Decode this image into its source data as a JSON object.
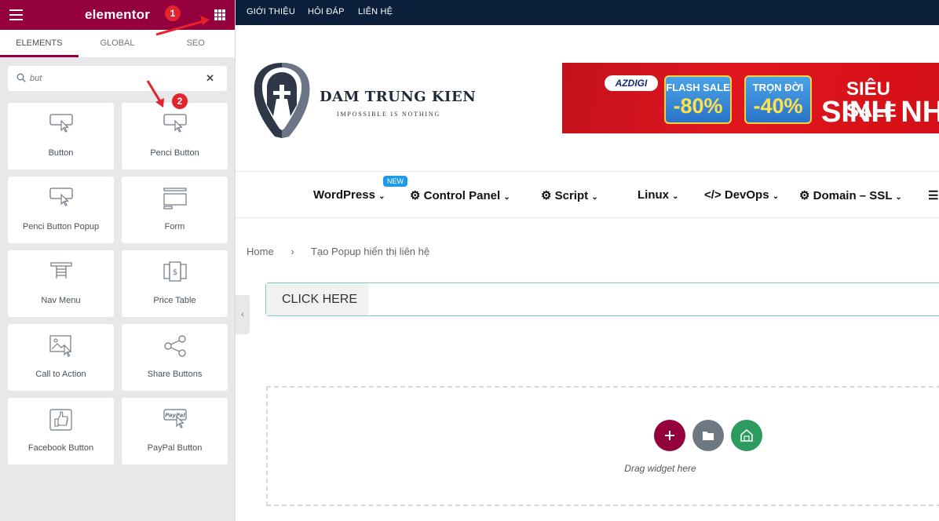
{
  "panel": {
    "brand": "elementor",
    "tabs": [
      "ELEMENTS",
      "GLOBAL",
      "SEO"
    ],
    "search": {
      "value": "but"
    },
    "badges": [
      "1",
      "2"
    ],
    "widgets": [
      {
        "label": "Button",
        "icon": "button-icon"
      },
      {
        "label": "Penci Button",
        "icon": "button-icon"
      },
      {
        "label": "Penci Button Popup",
        "icon": "button-icon"
      },
      {
        "label": "Form",
        "icon": "form-icon"
      },
      {
        "label": "Nav Menu",
        "icon": "nav-menu-icon"
      },
      {
        "label": "Price Table",
        "icon": "price-table-icon"
      },
      {
        "label": "Call to Action",
        "icon": "call-to-action-icon"
      },
      {
        "label": "Share Buttons",
        "icon": "share-icon"
      },
      {
        "label": "Facebook Button",
        "icon": "facebook-like-icon"
      },
      {
        "label": "PayPal Button",
        "icon": "paypal-icon"
      }
    ],
    "accent": "#93003c"
  },
  "site": {
    "topbar": [
      "GIỚI THIỆU",
      "HỎI ĐÁP",
      "LIÊN HỆ"
    ],
    "logo": {
      "name": "DAM TRUNG KIEN",
      "tagline": "IMPOSSIBLE IS NOTHING"
    },
    "banner": {
      "brand": "AZDIGI",
      "flash_title": "FLASH SALE",
      "flash_pct": "-80%",
      "life_title": "TRỌN ĐỜI",
      "life_pct": "-40%",
      "line1": "SIÊU SALE",
      "line2": "SINH NH"
    },
    "nav": {
      "new_badge": "NEW",
      "items": [
        "WordPress",
        "Control Panel",
        "Script",
        "Linux",
        "DevOps",
        "Domain – SSL"
      ]
    },
    "breadcrumb": {
      "home": "Home",
      "sep": "›",
      "current": "Tạo Popup hiển thị liên hệ"
    },
    "click_button": "CLICK HERE",
    "drop_hint": "Drag widget here"
  }
}
